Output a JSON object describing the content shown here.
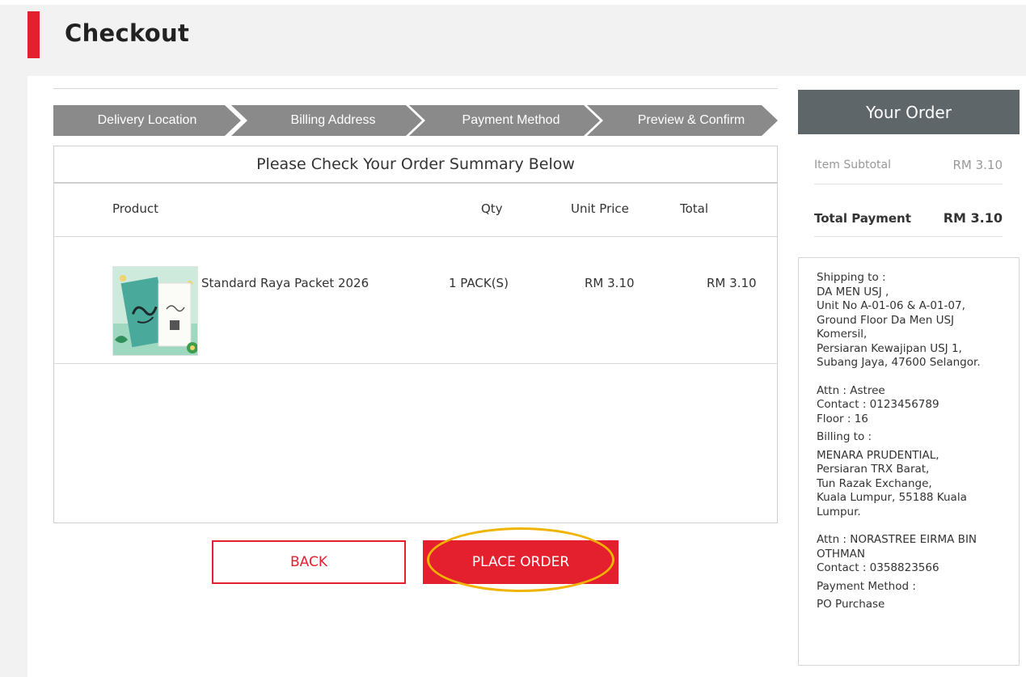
{
  "page": {
    "title": "Checkout"
  },
  "steps": [
    "Delivery Location",
    "Billing Address",
    "Payment Method",
    "Preview & Confirm"
  ],
  "summary": {
    "title": "Please Check Your Order Summary Below",
    "columns": {
      "product": "Product",
      "qty": "Qty",
      "unit_price": "Unit Price",
      "total": "Total"
    },
    "items": [
      {
        "name": "Standard Raya Packet 2026",
        "qty": "1 PACK(S)",
        "unit_price": "RM 3.10",
        "total": "RM 3.10"
      }
    ]
  },
  "buttons": {
    "back": "BACK",
    "place_order": "PLACE ORDER"
  },
  "order": {
    "title": "Your Order",
    "subtotal_label": "Item Subtotal",
    "subtotal_value": "RM 3.10",
    "total_label": "Total Payment",
    "total_value": "RM 3.10"
  },
  "shipping": {
    "label": "Shipping to :",
    "lines": [
      "DA MEN USJ ,",
      "Unit No A-01-06 & A-01-07,",
      "Ground Floor Da Men USJ",
      "Komersil,",
      "Persiaran Kewajipan USJ 1,",
      "Subang Jaya, 47600 Selangor."
    ],
    "attn": "Attn : Astree",
    "contact": "Contact : 0123456789",
    "floor": "Floor : 16"
  },
  "billing": {
    "label": "Billing to :",
    "lines": [
      "MENARA PRUDENTIAL,",
      "Persiaran TRX Barat,",
      "Tun Razak Exchange,",
      "Kuala Lumpur, 55188 Kuala",
      "Lumpur."
    ],
    "attn_lines": [
      "Attn : NORASTREE EIRMA BIN",
      "OTHMAN"
    ],
    "contact": "Contact : 0358823566"
  },
  "payment": {
    "label": "Payment Method :",
    "value": "PO Purchase"
  },
  "colors": {
    "accent": "#e4202e",
    "step_bg": "#8a8a8a",
    "order_header_bg": "#5f6669",
    "highlight": "#f0b400"
  }
}
